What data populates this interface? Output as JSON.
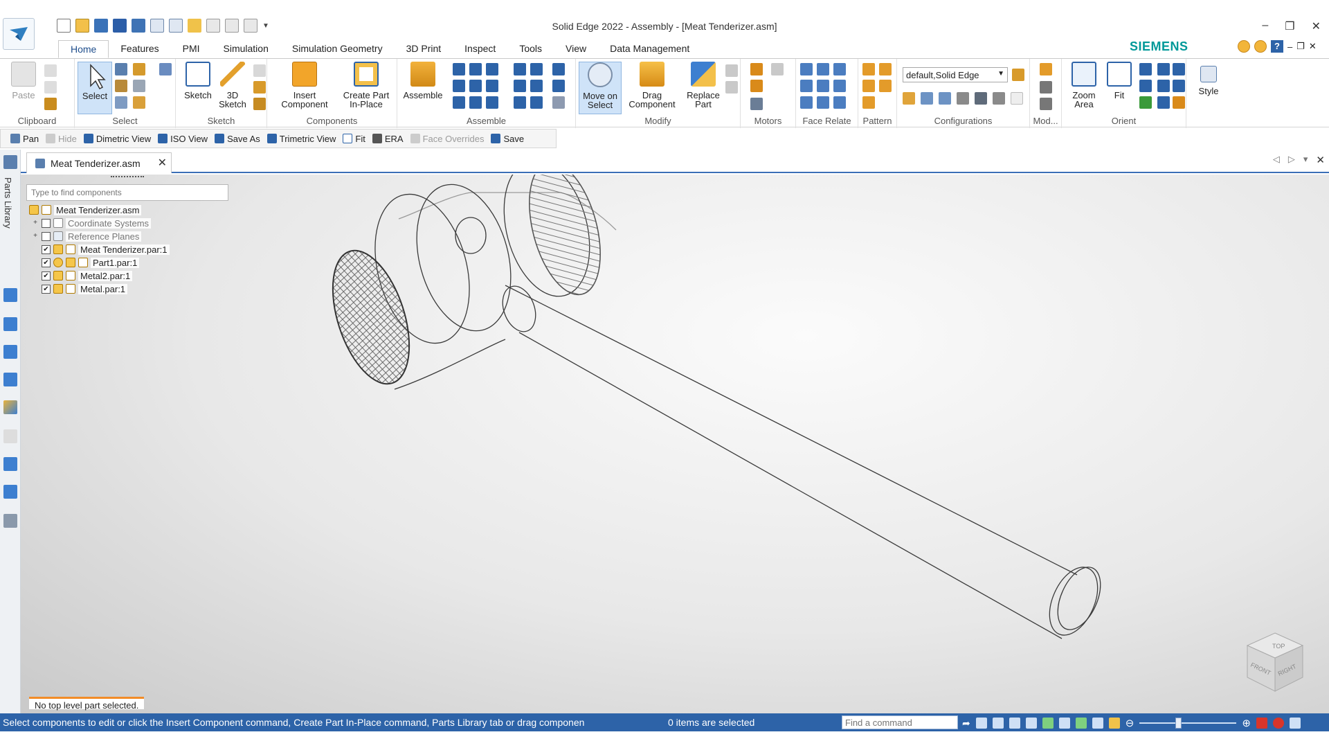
{
  "window": {
    "title": "Solid Edge 2022 - Assembly - [Meat Tenderizer.asm]",
    "brand": "SIEMENS",
    "controls": [
      "–",
      "❐",
      "✕"
    ]
  },
  "ribbon_tabs": [
    "Home",
    "Features",
    "PMI",
    "Simulation",
    "Simulation Geometry",
    "3D Print",
    "Inspect",
    "Tools",
    "View",
    "Data Management"
  ],
  "ribbon": {
    "clipboard": {
      "paste": "Paste",
      "label": "Clipboard"
    },
    "select": {
      "select": "Select",
      "label": "Select"
    },
    "sketch": {
      "sketch": "Sketch",
      "sketch3d_line1": "3D",
      "sketch3d_line2": "Sketch",
      "label": "Sketch"
    },
    "components": {
      "insert_line1": "Insert",
      "insert_line2": "Component",
      "create_line1": "Create Part",
      "create_line2": "In-Place",
      "label": "Components"
    },
    "assemble": {
      "assemble": "Assemble",
      "label": "Assemble"
    },
    "modify": {
      "move_line1": "Move on",
      "move_line2": "Select",
      "drag_line1": "Drag",
      "drag_line2": "Component",
      "replace_line1": "Replace",
      "replace_line2": "Part",
      "label": "Modify"
    },
    "motors": {
      "label": "Motors"
    },
    "face_relate": {
      "label": "Face Relate"
    },
    "pattern": {
      "label": "Pattern"
    },
    "configurations": {
      "value": "default,Solid Edge",
      "label": "Configurations"
    },
    "mod": {
      "label": "Mod..."
    },
    "orient": {
      "zoom_line1": "Zoom",
      "zoom_line2": "Area",
      "fit": "Fit",
      "label": "Orient"
    },
    "style": {
      "style": "Style"
    }
  },
  "command_bar": {
    "pan": "Pan",
    "hide": "Hide",
    "dimetric": "Dimetric View",
    "iso": "ISO View",
    "save_as": "Save As",
    "trimetric": "Trimetric View",
    "fit": "Fit",
    "era": "ERA",
    "face_overrides": "Face Overrides",
    "save": "Save"
  },
  "left_rail": {
    "parts_library": "Parts Library"
  },
  "document_tab": {
    "name": "Meat Tenderizer.asm",
    "close": "✕"
  },
  "pathfinder": {
    "search_placeholder": "Type to find components",
    "root": "Meat Tenderizer.asm",
    "items": [
      {
        "label": "Coordinate Systems",
        "checked": false,
        "expandable": true
      },
      {
        "label": "Reference Planes",
        "checked": false,
        "expandable": true
      },
      {
        "label": "Meat Tenderizer.par:1",
        "checked": true,
        "expandable": false
      },
      {
        "label": "Part1.par:1",
        "checked": true,
        "expandable": false
      },
      {
        "label": "Metal2.par:1",
        "checked": true,
        "expandable": false
      },
      {
        "label": "Metal.par:1",
        "checked": true,
        "expandable": false
      }
    ],
    "selection_message": "No top level part selected."
  },
  "viewcube": {
    "top": "TOP",
    "front": "FRONT",
    "right": "RIGHT"
  },
  "status": {
    "prompt": "Select components to edit or click the Insert Component command, Create Part In-Place command, Parts Library tab or drag componen",
    "count": "0 items are selected",
    "find_placeholder": "Find a command",
    "zoom_level": 0.4
  },
  "colors": {
    "status_bar": "#2d63a8",
    "brand": "#009999",
    "accent_orange": "#f28c28"
  }
}
